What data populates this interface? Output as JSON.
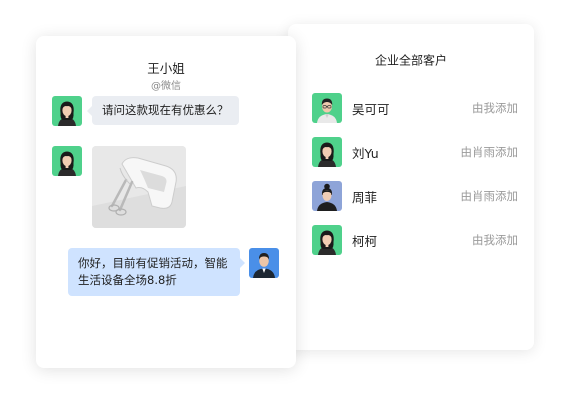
{
  "customer_list": {
    "title": "企业全部客户",
    "customers": [
      {
        "name": "吴可可",
        "added_by": "由我添加",
        "avatar": "avatar-man-glasses",
        "bg": "#4fd18b"
      },
      {
        "name": "刘Yu",
        "added_by": "由肖雨添加",
        "avatar": "avatar-woman",
        "bg": "#4fd18b"
      },
      {
        "name": "周菲",
        "added_by": "由肖雨添加",
        "avatar": "avatar-woman-bun",
        "bg": "#8ea4d8"
      },
      {
        "name": "柯柯",
        "added_by": "由我添加",
        "avatar": "avatar-woman",
        "bg": "#4fd18b"
      }
    ]
  },
  "chat": {
    "contact_name": "王小姐",
    "contact_source": "@微信",
    "messages": [
      {
        "from": "customer",
        "type": "text",
        "text": "请问这款现在有优惠么？"
      },
      {
        "from": "customer",
        "type": "image",
        "image": "hand-mixer-photo"
      },
      {
        "from": "staff",
        "type": "text",
        "text": "你好，目前有促销活动，智能生活设备全场8.8折"
      }
    ]
  },
  "colors": {
    "bubble_incoming": "#eaedf2",
    "bubble_outgoing": "#cfe3ff",
    "avatar_green": "#4fd18b",
    "avatar_blue": "#4a8fe8"
  }
}
